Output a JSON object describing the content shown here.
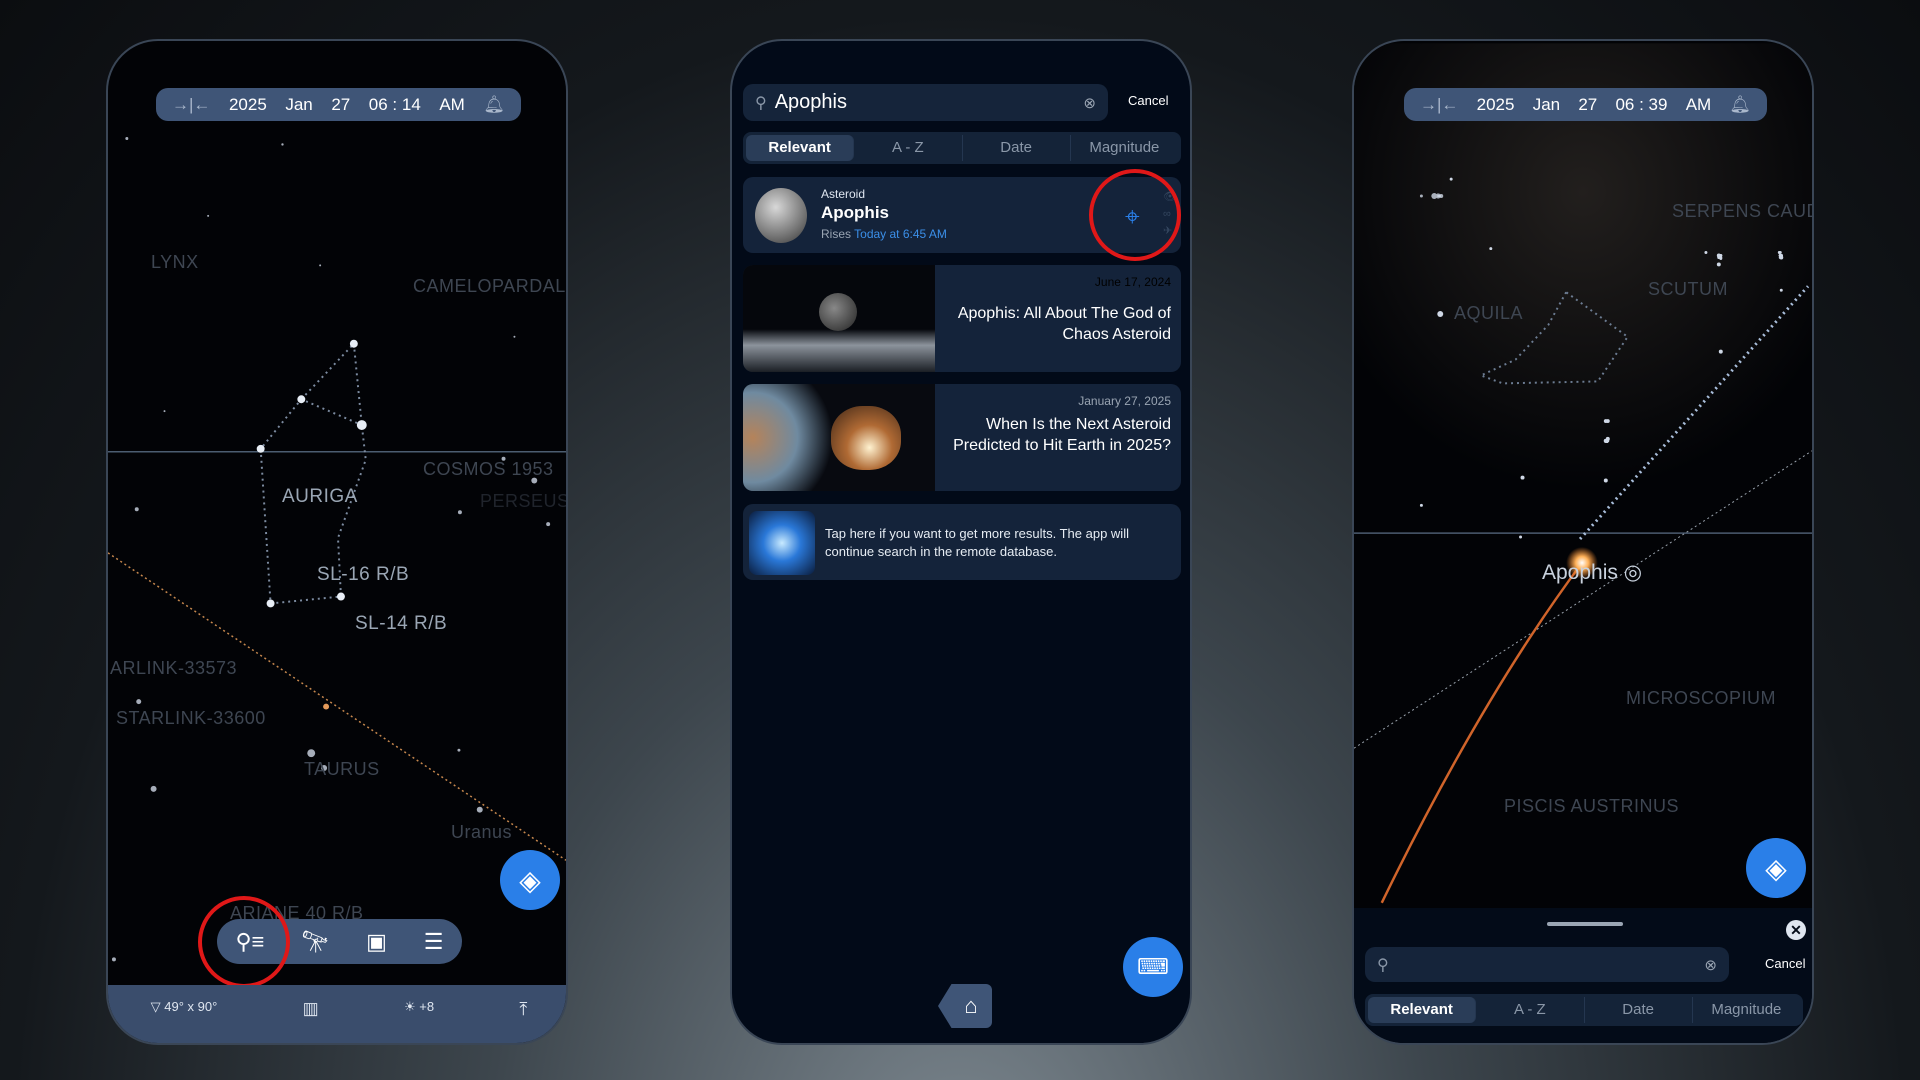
{
  "left_phone": {
    "time": {
      "year": "2025",
      "month": "Jan",
      "day": "27",
      "time": "06 : 14",
      "ampm": "AM"
    },
    "sky_labels": [
      "LYNX",
      "CAMELOPARDAL",
      "COSMOS 1953",
      "AURIGA",
      "SL-16 R/B",
      "SL-14 R/B",
      "ARLINK-33573",
      "STARLINK-33600",
      "TAURUS",
      "Uranus",
      "PERSEUS",
      "ARIANE 40 R/B"
    ],
    "toolbar": [
      "search-list-icon",
      "telescope-icon",
      "calendar-night-icon",
      "menu-icon"
    ],
    "status": {
      "fov": "49° x 90°",
      "brightness": "+8"
    }
  },
  "middle_phone": {
    "search": {
      "value": "Apophis",
      "cancel": "Cancel"
    },
    "tabs": [
      "Relevant",
      "A - Z",
      "Date",
      "Magnitude"
    ],
    "active_tab": "Relevant",
    "result": {
      "type": "Asteroid",
      "name": "Apophis",
      "rises_label": "Rises",
      "rises_time": "Today at 6:45 AM"
    },
    "articles": [
      {
        "date": "June 17, 2024",
        "title": "Apophis: All About The God of Chaos Asteroid"
      },
      {
        "date": "January 27, 2025",
        "title": "When Is the Next Asteroid Predicted to Hit Earth in 2025?"
      }
    ],
    "remote": "Tap here if you want to get more results. The app will continue search in the remote database."
  },
  "right_phone": {
    "time": {
      "year": "2025",
      "month": "Jan",
      "day": "27",
      "time": "06 : 39",
      "ampm": "AM"
    },
    "sky_labels": [
      "SERPENS CAUD",
      "SCUTUM",
      "AQUILA",
      "MICROSCOPIUM",
      "PISCIS AUSTRINUS"
    ],
    "target_label": "Apophis",
    "search": {
      "value": "",
      "cancel": "Cancel"
    },
    "tabs": [
      "Relevant",
      "A - Z",
      "Date",
      "Magnitude"
    ]
  },
  "colors": {
    "accent": "#2a7fe8",
    "highlight_ring": "#e01818",
    "link": "#3b8fe8",
    "bar": "#3f5577"
  }
}
